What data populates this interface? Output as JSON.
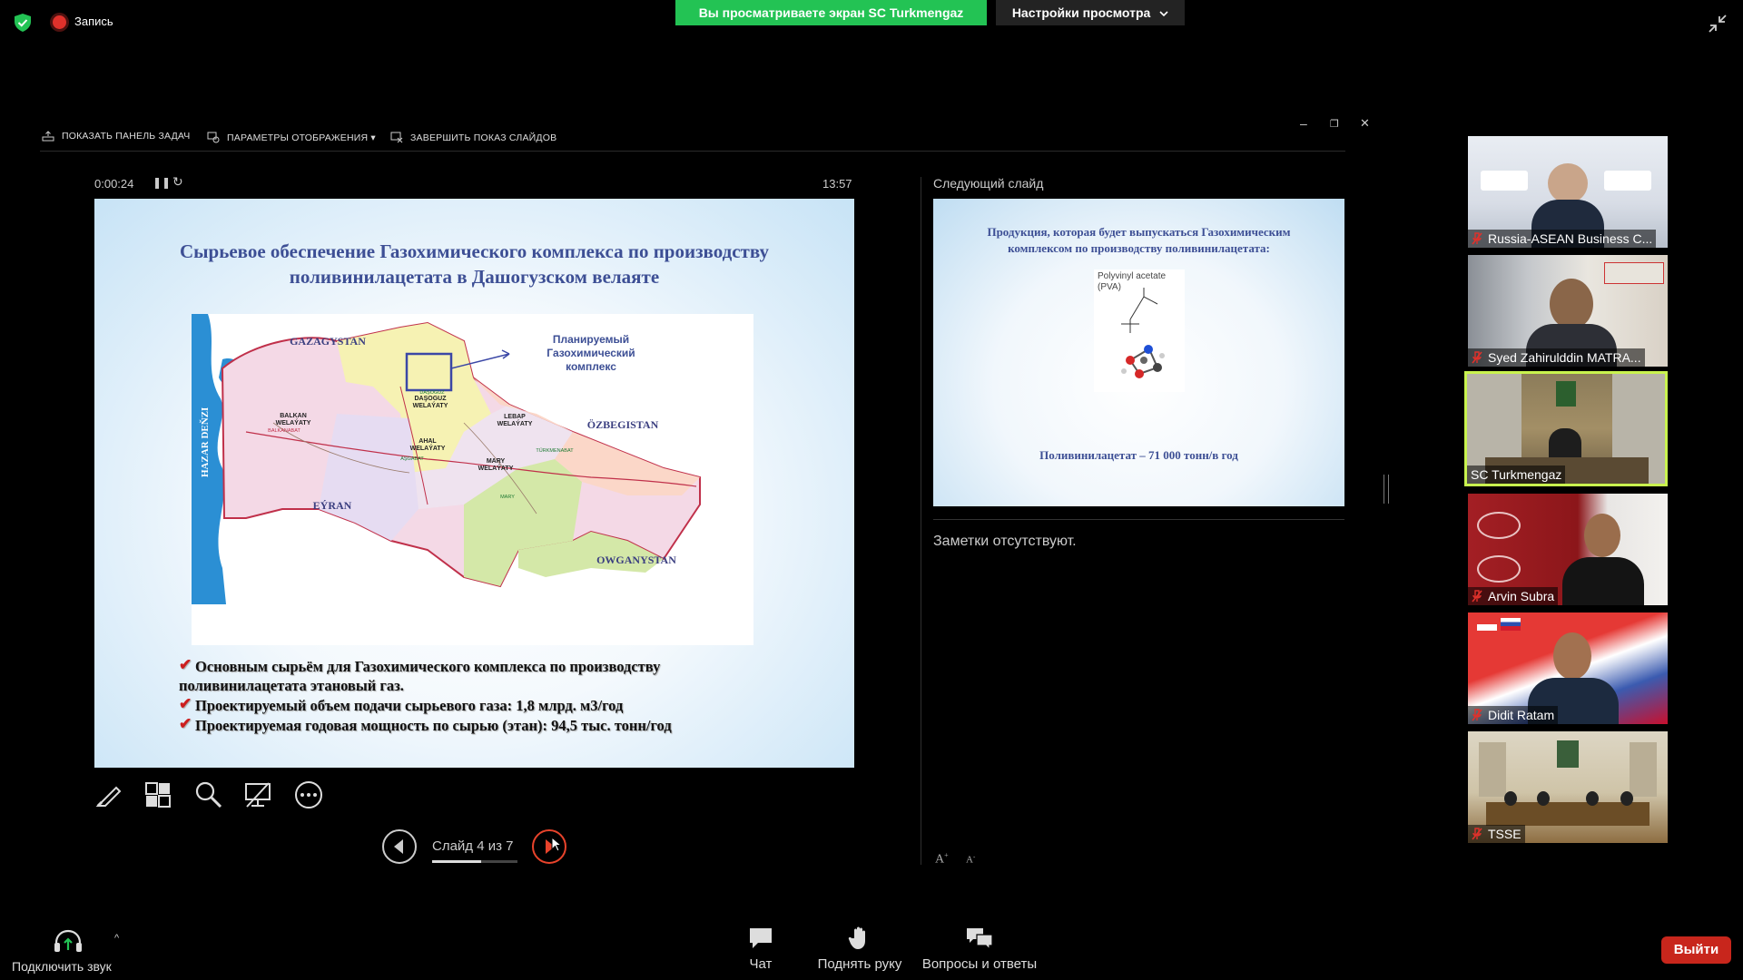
{
  "top_bar": {
    "recording_label": "Запись",
    "share_banner": "Вы просматриваете экран SC Turkmengaz",
    "view_options_label": "Настройки просмотра"
  },
  "presenter_toolbar": {
    "show_taskbar": "ПОКАЗАТЬ ПАНЕЛЬ ЗАДАЧ",
    "display_settings": "ПАРАМЕТРЫ ОТОБРАЖЕНИЯ ▾",
    "end_show": "ЗАВЕРШИТЬ ПОКАЗ СЛАЙДОВ"
  },
  "presenter": {
    "elapsed": "0:00:24",
    "clock": "13:57",
    "slide_counter": "Слайд 4 из 7",
    "current_slide_index": 4,
    "total_slides": 7,
    "next_slide_label": "Следующий слайд",
    "notes_text": "Заметки отсутствуют."
  },
  "current_slide": {
    "title_line1": "Сырьевое обеспечение Газохимического комплекса по производству",
    "title_line2": "поливинилацетата в Дашогузском велаяте",
    "map": {
      "sea_label": "HAZAR DEŇZI",
      "callout": [
        "Планируемый",
        "Газохимический",
        "комплекс"
      ],
      "countries": [
        "GAZAGYSTAN",
        "ÖZBEGISTAN",
        "EÝRAN",
        "OWGANYSTAN"
      ],
      "regions": [
        [
          "DAŞOGUZ",
          "WELAÝATY"
        ],
        [
          "BALKAN",
          "WELAÝATY"
        ],
        [
          "AHAL",
          "WELAÝATY"
        ],
        [
          "LEBAP",
          "WELAÝATY"
        ],
        [
          "MARY",
          "WELAÝATY"
        ]
      ],
      "cities": [
        "DAŞOGUZ",
        "BALKANABAT",
        "AŞGABAT",
        "MARY",
        "TÜRKMENABAT"
      ]
    },
    "bullets": [
      {
        "line1": "Основным сырьём для Газохимического комплекса по производству",
        "line2": "поливинилацетата этановый газ."
      },
      {
        "line1": "Проектируемый объем подачи сырьевого газа: 1,8 млрд. м3/год"
      },
      {
        "line1": "Проектируемая годовая мощность по сырью (этан): 94,5 тыс. тонн/год"
      }
    ]
  },
  "next_slide": {
    "title_line1": "Продукция, которая будет выпускаться Газохимическим",
    "title_line2": "комплексом по производству поливинилацетата:",
    "molecule_label_line1": "Polyvinyl acetate",
    "molecule_label_line2": "(PVA)",
    "caption": "Поливинилацетат – 71 000 тонн/в год"
  },
  "participants": [
    {
      "name": "Russia-ASEAN Business C...",
      "muted": true,
      "active": false
    },
    {
      "name": "Syed Zahirulddin MATRA...",
      "muted": true,
      "active": false
    },
    {
      "name": "SC Turkmengaz",
      "muted": false,
      "active": true
    },
    {
      "name": "Arvin Subra",
      "muted": true,
      "active": false
    },
    {
      "name": "Didit Ratam",
      "muted": true,
      "active": false
    },
    {
      "name": "TSSE",
      "muted": true,
      "active": false
    }
  ],
  "bottom_bar": {
    "audio_label": "Подключить звук",
    "chat_label": "Чат",
    "raise_hand_label": "Поднять руку",
    "qa_label": "Вопросы и ответы",
    "leave_label": "Выйти"
  },
  "colors": {
    "share_banner": "#23c354",
    "leave_button": "#c8261c",
    "active_speaker_border": "#c9f34e",
    "slide_title": "#3d4f95",
    "next_button_accent": "#e8432b"
  }
}
